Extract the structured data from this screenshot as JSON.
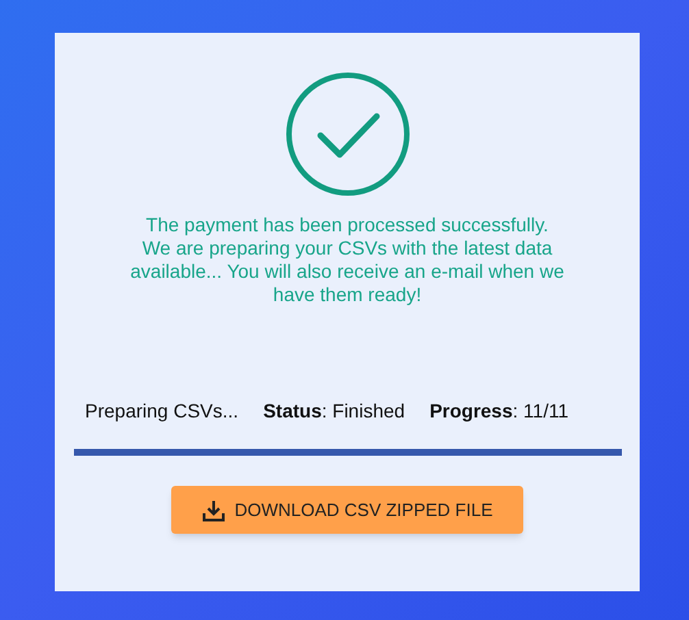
{
  "message": "The payment has been processed successfully.\nWe are preparing your CSVs with the latest data available... You will also receive an e-mail when we have them ready!",
  "status_line": {
    "stage": "Preparing CSVs...",
    "status": "**Status**: Finished",
    "progress": "**Progress**: 11/11"
  },
  "progress_bar": {
    "level": 1
  },
  "download_button": {
    "label": "DOWNLOAD CSV ZIPPED FILE"
  }
}
